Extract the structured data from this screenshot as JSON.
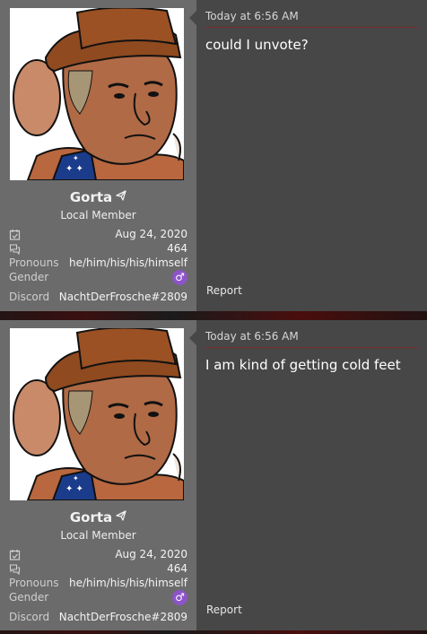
{
  "posts": [
    {
      "user": {
        "name": "Gorta",
        "name_icon": "paper-plane-icon",
        "title": "Local Member",
        "joined": "Aug 24, 2020",
        "joined_icon": "calendar-check-icon",
        "messages": "464",
        "messages_icon": "chat-bubbles-icon",
        "pronouns_label": "Pronouns",
        "pronouns": "he/him/his/his/himself",
        "gender_label": "Gender",
        "gender_icon": "male-symbol-icon",
        "discord_label": "Discord",
        "discord": "NachtDerFrosche#2809"
      },
      "timestamp": "Today at 6:56 AM",
      "text": "could I unvote?",
      "report_label": "Report"
    },
    {
      "user": {
        "name": "Gorta",
        "name_icon": "paper-plane-icon",
        "title": "Local Member",
        "joined": "Aug 24, 2020",
        "joined_icon": "calendar-check-icon",
        "messages": "464",
        "messages_icon": "chat-bubbles-icon",
        "pronouns_label": "Pronouns",
        "pronouns": "he/him/his/his/himself",
        "gender_label": "Gender",
        "gender_icon": "male-symbol-icon",
        "discord_label": "Discord",
        "discord": "NachtDerFrosche#2809"
      },
      "timestamp": "Today at 6:56 AM",
      "text": "I am kind of getting cold feet",
      "report_label": "Report"
    }
  ],
  "colors": {
    "user_panel": "#6b6b6b",
    "content_panel": "#474747",
    "gender_badge": "#8d54c9",
    "divider": "#7a2c2c"
  }
}
